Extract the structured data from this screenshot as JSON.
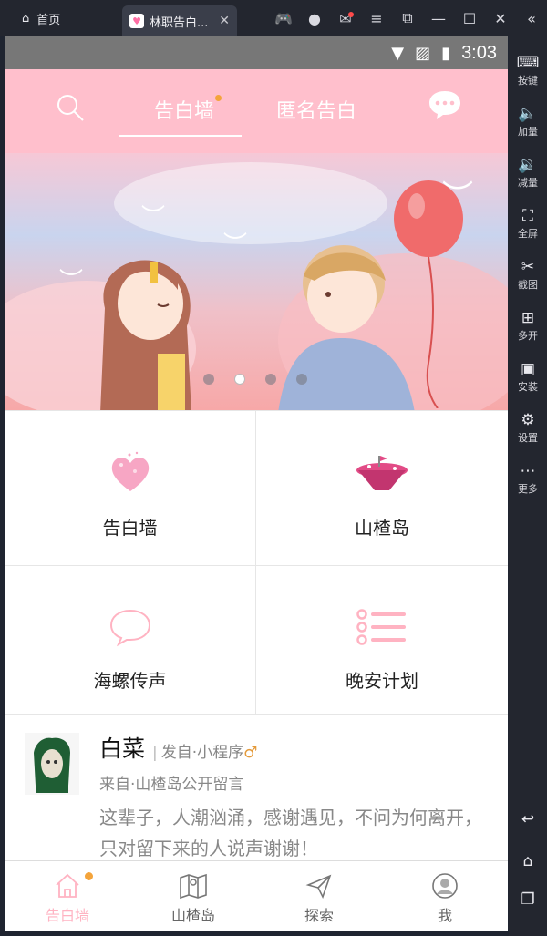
{
  "emulator": {
    "home_tab_label": "首页",
    "app_tab_label": "林职告白...",
    "side_panel": [
      {
        "label": "按键",
        "icon": "keyboard-icon"
      },
      {
        "label": "加量",
        "icon": "volume-up-icon"
      },
      {
        "label": "减量",
        "icon": "volume-down-icon"
      },
      {
        "label": "全屏",
        "icon": "fullscreen-icon"
      },
      {
        "label": "截图",
        "icon": "scissors-icon"
      },
      {
        "label": "多开",
        "icon": "multi-instance-icon"
      },
      {
        "label": "安装",
        "icon": "apk-install-icon"
      },
      {
        "label": "设置",
        "icon": "settings-icon"
      },
      {
        "label": "更多",
        "icon": "more-icon"
      }
    ]
  },
  "statusbar": {
    "time": "3:03"
  },
  "appbar": {
    "tabs": [
      {
        "label": "告白墙",
        "active": true,
        "badge": true
      },
      {
        "label": "匿名告白",
        "active": false
      }
    ]
  },
  "banner": {
    "dots": 4,
    "active_dot": 1
  },
  "grid": [
    {
      "label": "告白墙",
      "icon": "pink-heart-icon"
    },
    {
      "label": "山楂岛",
      "icon": "floating-island-icon"
    },
    {
      "label": "海螺传声",
      "icon": "speech-bubble-icon"
    },
    {
      "label": "晚安计划",
      "icon": "list-icon"
    }
  ],
  "post": {
    "name": "白菜",
    "source": "发自·小程序",
    "gender_symbol": "♂",
    "from": "来自·山楂岛公开留言",
    "body": "这辈子，人潮汹涌，感谢遇见，不问为何离开，只对留下来的人说声谢谢！"
  },
  "bottom_nav": [
    {
      "label": "告白墙",
      "icon": "home-icon",
      "active": true,
      "badge": true
    },
    {
      "label": "山楂岛",
      "icon": "map-icon",
      "active": false
    },
    {
      "label": "探索",
      "icon": "send-icon",
      "active": false
    },
    {
      "label": "我",
      "icon": "profile-icon",
      "active": false
    }
  ],
  "colors": {
    "appbar_pink": "#ffbfcc",
    "badge_orange": "#f4a43b",
    "active_nav": "#ffb3c2"
  }
}
